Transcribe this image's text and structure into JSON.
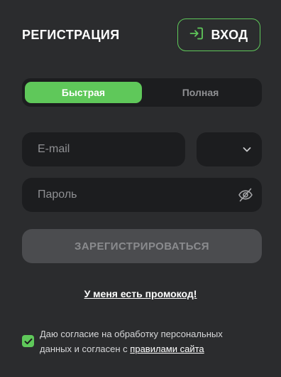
{
  "header": {
    "title": "РЕГИСТРАЦИЯ",
    "login_label": "ВХОД",
    "login_icon": "sign-in-icon"
  },
  "tabs": [
    {
      "label": "Быстрая",
      "active": true
    },
    {
      "label": "Полная",
      "active": false
    }
  ],
  "form": {
    "email_placeholder": "E-mail",
    "email_value": "",
    "domain_value": "",
    "domain_icon": "chevron-down-icon",
    "password_placeholder": "Пароль",
    "password_value": "",
    "password_toggle_icon": "eye-off-icon",
    "submit_label": "ЗАРЕГИСТРИРОВАТЬСЯ"
  },
  "promo_label": "У меня есть промокод!",
  "consent": {
    "checked": true,
    "text_line1": "Даю согласие на обработку персональных",
    "text_line2": "данных и согласен с ",
    "rules_link": "правилами сайта"
  },
  "colors": {
    "background": "#2b2c2e",
    "field_background": "#1c1d1f",
    "accent": "#5fc85a",
    "disabled_button": "#4b4c4f",
    "muted_text": "#8f9093"
  }
}
